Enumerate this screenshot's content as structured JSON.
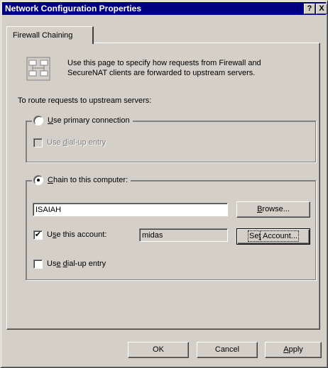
{
  "window": {
    "title": "Network Configuration Properties",
    "help_button": "?",
    "close_button": "X"
  },
  "tab": {
    "label": "Firewall Chaining"
  },
  "intro": {
    "text": "Use this page to specify how requests from Firewall and SecureNAT clients are forwarded to upstream servers.",
    "icon": "network-chaining-icon"
  },
  "route_label": "To route requests to upstream servers:",
  "group_primary": {
    "radio_label_ul": "U",
    "radio_label_rest": "se primary connection",
    "selected": false,
    "dialup": {
      "pre": "Use ",
      "ul": "d",
      "post": "ial-up entry",
      "checked": false,
      "enabled": false
    }
  },
  "group_chain": {
    "radio_label_ul": "C",
    "radio_label_rest": "hain to this computer:",
    "selected": true,
    "computer_value": "ISAIAH",
    "browse_label": {
      "ul": "B",
      "rest": "rowse..."
    },
    "account_check": {
      "pre": "U",
      "ul": "s",
      "post": "e this account:",
      "checked": true
    },
    "account_value": "midas",
    "set_account_label": {
      "pre": "Se",
      "ul": "t",
      "post": " Account..."
    },
    "dialup": {
      "pre": "Us",
      "ul": "e",
      "mid": " ",
      "ul2": "d",
      "post": "ial-up entry",
      "checked": false
    }
  },
  "footer": {
    "ok": "OK",
    "cancel": "Cancel",
    "apply_ul": "A",
    "apply_rest": "pply"
  }
}
